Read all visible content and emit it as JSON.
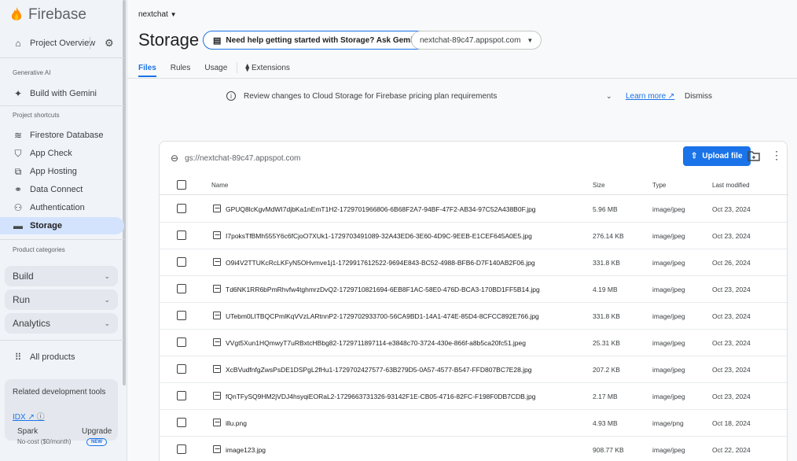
{
  "sidebar": {
    "brand": "Firebase",
    "project_overview": "Project Overview",
    "caption_genai": "Generative AI",
    "build_with_gemini": "Build with Gemini",
    "caption_shortcuts": "Project shortcuts",
    "items": [
      {
        "label": "Firestore Database",
        "icon": "firestore-icon"
      },
      {
        "label": "App Check",
        "icon": "shield-icon"
      },
      {
        "label": "App Hosting",
        "icon": "hosting-icon"
      },
      {
        "label": "Data Connect",
        "icon": "data-connect-icon"
      },
      {
        "label": "Authentication",
        "icon": "people-icon"
      },
      {
        "label": "Storage",
        "icon": "storage-icon"
      }
    ],
    "caption_categories": "Product categories",
    "groups": [
      "Build",
      "Run",
      "Analytics"
    ],
    "all_products": "All products",
    "related_title": "Related development tools",
    "idx": "IDX",
    "plan": "Spark",
    "plan_sub": "No-cost ($0/month)",
    "upgrade": "Upgrade",
    "new_badge": "NEW"
  },
  "header": {
    "project": "nextchat",
    "title": "Storage",
    "gemini_prompt": "Need help getting started with Storage? Ask Gemini",
    "bucket": "nextchat-89c47.appspot.com",
    "tabs": [
      "Files",
      "Rules",
      "Usage",
      "Extensions"
    ]
  },
  "banner": {
    "text": "Review changes to Cloud Storage for Firebase pricing plan requirements",
    "learn_more": "Learn more",
    "dismiss": "Dismiss"
  },
  "files": {
    "path": "gs://nextchat-89c47.appspot.com",
    "upload": "Upload file",
    "columns": {
      "name": "Name",
      "size": "Size",
      "type": "Type",
      "modified": "Last modified"
    },
    "rows": [
      {
        "name": "GPUQ8lcKgvMdWI7djbKa1nEmT1H2-1729701966806-6B68F2A7-94BF-47F2-AB34-97C52A438B0F.jpg",
        "size": "5.96 MB",
        "type": "image/jpeg",
        "modified": "Oct 23, 2024"
      },
      {
        "name": "I7poksTfBMh555Y6c6fCjoO7XUk1-1729703491089-32A43ED6-3E60-4D9C-9EEB-E1CEF645A0E5.jpg",
        "size": "276.14 KB",
        "type": "image/jpeg",
        "modified": "Oct 23, 2024"
      },
      {
        "name": "O9i4V2TTUKcRcLKFyN5OHvmve1j1-1729917612522-9694E843-BC52-4988-BFB6-D7F140AB2F06.jpg",
        "size": "331.8 KB",
        "type": "image/jpeg",
        "modified": "Oct 26, 2024"
      },
      {
        "name": "Td6NK1RR6bPmRhvfw4tghmrzDvQ2-1729710821694-6EB8F1AC-58E0-476D-BCA3-170BD1FF5B14.jpg",
        "size": "4.19 MB",
        "type": "image/jpeg",
        "modified": "Oct 23, 2024"
      },
      {
        "name": "UTebm0LITBQCPmlKqVVzLARtnnP2-1729702933700-56CA9BD1-14A1-474E-85D4-8CFCC892E766.jpg",
        "size": "331.8 KB",
        "type": "image/jpeg",
        "modified": "Oct 23, 2024"
      },
      {
        "name": "VVgt5Xun1HQmwyT7uRBxtcHBbg82-1729711897114-e3848c70-3724-430e-866f-a8b5ca20fc51.jpeg",
        "size": "25.31 KB",
        "type": "image/jpeg",
        "modified": "Oct 23, 2024"
      },
      {
        "name": "XcBVudfnfgZwsPsDE1DSPgL2fHu1-1729702427577-63B279D5-0A57-4577-B547-FFD807BC7E28.jpg",
        "size": "207.2 KB",
        "type": "image/jpeg",
        "modified": "Oct 23, 2024"
      },
      {
        "name": "fQnTFySQ9HM2jVDJ4hsyqiEORaL2-1729663731326-93142F1E-CB05-4716-82FC-F198F0DB7CDB.jpg",
        "size": "2.17 MB",
        "type": "image/jpeg",
        "modified": "Oct 23, 2024"
      },
      {
        "name": "illu.png",
        "size": "4.93 MB",
        "type": "image/png",
        "modified": "Oct 18, 2024"
      },
      {
        "name": "image123.jpg",
        "size": "908.77 KB",
        "type": "image/jpeg",
        "modified": "Oct 22, 2024"
      }
    ]
  },
  "colors": {
    "accent": "#1a73e8",
    "sidebar_active": "#d3e3fd",
    "flame_orange": "#ff9100",
    "flame_yellow": "#ffc400"
  }
}
